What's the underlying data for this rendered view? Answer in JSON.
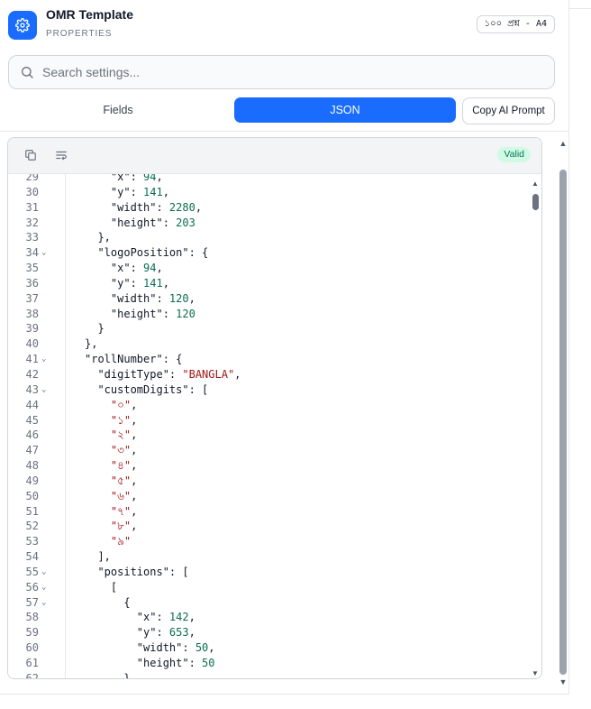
{
  "header": {
    "title": "OMR Template",
    "subtitle": "PROPERTIES",
    "size_badge": "১০০ প্রশ্ন - A4",
    "icon": "gear-icon"
  },
  "search": {
    "placeholder": "Search settings...",
    "value": "",
    "icon": "search-icon"
  },
  "tabs": [
    {
      "label": "Fields",
      "active": false
    },
    {
      "label": "JSON",
      "active": true
    }
  ],
  "copy_ai_label": "Copy AI Prompt",
  "editor": {
    "toolbar_icons": [
      "copy-icon",
      "wrap-text-icon"
    ],
    "status": "Valid",
    "lines": [
      {
        "n": "29",
        "fold": false,
        "parts": [
          [
            "k",
            "    \"x\": "
          ],
          [
            "n",
            "94"
          ],
          [
            "k",
            ","
          ]
        ]
      },
      {
        "n": "30",
        "fold": false,
        "parts": [
          [
            "k",
            "    \"y\": "
          ],
          [
            "n",
            "141"
          ],
          [
            "k",
            ","
          ]
        ]
      },
      {
        "n": "31",
        "fold": false,
        "parts": [
          [
            "k",
            "    \"width\": "
          ],
          [
            "n",
            "2280"
          ],
          [
            "k",
            ","
          ]
        ]
      },
      {
        "n": "32",
        "fold": false,
        "parts": [
          [
            "k",
            "    \"height\": "
          ],
          [
            "n",
            "203"
          ]
        ]
      },
      {
        "n": "33",
        "fold": false,
        "parts": [
          [
            "k",
            "  },"
          ]
        ]
      },
      {
        "n": "34",
        "fold": true,
        "parts": [
          [
            "k",
            "  \"logoPosition\": {"
          ]
        ]
      },
      {
        "n": "35",
        "fold": false,
        "parts": [
          [
            "k",
            "    \"x\": "
          ],
          [
            "n",
            "94"
          ],
          [
            "k",
            ","
          ]
        ]
      },
      {
        "n": "36",
        "fold": false,
        "parts": [
          [
            "k",
            "    \"y\": "
          ],
          [
            "n",
            "141"
          ],
          [
            "k",
            ","
          ]
        ]
      },
      {
        "n": "37",
        "fold": false,
        "parts": [
          [
            "k",
            "    \"width\": "
          ],
          [
            "n",
            "120"
          ],
          [
            "k",
            ","
          ]
        ]
      },
      {
        "n": "38",
        "fold": false,
        "parts": [
          [
            "k",
            "    \"height\": "
          ],
          [
            "n",
            "120"
          ]
        ]
      },
      {
        "n": "39",
        "fold": false,
        "parts": [
          [
            "k",
            "  }"
          ]
        ]
      },
      {
        "n": "40",
        "fold": false,
        "parts": [
          [
            "k",
            "},"
          ]
        ]
      },
      {
        "n": "41",
        "fold": true,
        "parts": [
          [
            "k",
            "\"rollNumber\": {"
          ]
        ]
      },
      {
        "n": "42",
        "fold": false,
        "parts": [
          [
            "k",
            "  \"digitType\": "
          ],
          [
            "s",
            "\"BANGLA\""
          ],
          [
            "k",
            ","
          ]
        ]
      },
      {
        "n": "43",
        "fold": true,
        "parts": [
          [
            "k",
            "  \"customDigits\": ["
          ]
        ]
      },
      {
        "n": "44",
        "fold": false,
        "parts": [
          [
            "s",
            "    \"০\""
          ],
          [
            "k",
            ","
          ]
        ]
      },
      {
        "n": "45",
        "fold": false,
        "parts": [
          [
            "s",
            "    \"১\""
          ],
          [
            "k",
            ","
          ]
        ]
      },
      {
        "n": "46",
        "fold": false,
        "parts": [
          [
            "s",
            "    \"২\""
          ],
          [
            "k",
            ","
          ]
        ]
      },
      {
        "n": "47",
        "fold": false,
        "parts": [
          [
            "s",
            "    \"৩\""
          ],
          [
            "k",
            ","
          ]
        ]
      },
      {
        "n": "48",
        "fold": false,
        "parts": [
          [
            "s",
            "    \"৪\""
          ],
          [
            "k",
            ","
          ]
        ]
      },
      {
        "n": "49",
        "fold": false,
        "parts": [
          [
            "s",
            "    \"৫\""
          ],
          [
            "k",
            ","
          ]
        ]
      },
      {
        "n": "50",
        "fold": false,
        "parts": [
          [
            "s",
            "    \"৬\""
          ],
          [
            "k",
            ","
          ]
        ]
      },
      {
        "n": "51",
        "fold": false,
        "parts": [
          [
            "s",
            "    \"৭\""
          ],
          [
            "k",
            ","
          ]
        ]
      },
      {
        "n": "52",
        "fold": false,
        "parts": [
          [
            "s",
            "    \"৮\""
          ],
          [
            "k",
            ","
          ]
        ]
      },
      {
        "n": "53",
        "fold": false,
        "parts": [
          [
            "s",
            "    \"৯\""
          ]
        ]
      },
      {
        "n": "54",
        "fold": false,
        "parts": [
          [
            "k",
            "  ],"
          ]
        ]
      },
      {
        "n": "55",
        "fold": true,
        "parts": [
          [
            "k",
            "  \"positions\": ["
          ]
        ]
      },
      {
        "n": "56",
        "fold": true,
        "parts": [
          [
            "k",
            "    ["
          ]
        ]
      },
      {
        "n": "57",
        "fold": true,
        "parts": [
          [
            "k",
            "      {"
          ]
        ]
      },
      {
        "n": "58",
        "fold": false,
        "parts": [
          [
            "k",
            "        \"x\": "
          ],
          [
            "n",
            "142"
          ],
          [
            "k",
            ","
          ]
        ]
      },
      {
        "n": "59",
        "fold": false,
        "parts": [
          [
            "k",
            "        \"y\": "
          ],
          [
            "n",
            "653"
          ],
          [
            "k",
            ","
          ]
        ]
      },
      {
        "n": "60",
        "fold": false,
        "parts": [
          [
            "k",
            "        \"width\": "
          ],
          [
            "n",
            "50"
          ],
          [
            "k",
            ","
          ]
        ]
      },
      {
        "n": "61",
        "fold": false,
        "parts": [
          [
            "k",
            "        \"height\": "
          ],
          [
            "n",
            "50"
          ]
        ]
      },
      {
        "n": "62",
        "fold": false,
        "parts": [
          [
            "k",
            "      },"
          ]
        ]
      }
    ]
  },
  "colors": {
    "accent": "#1a6cff",
    "valid_bg": "#d1fae5",
    "valid_text": "#047857",
    "number": "#0b6e4f",
    "string": "#a31515"
  }
}
